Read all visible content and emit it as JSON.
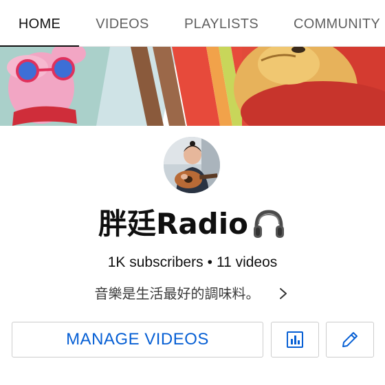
{
  "tabs": [
    {
      "label": "HOME",
      "active": true
    },
    {
      "label": "VIDEOS",
      "active": false
    },
    {
      "label": "PLAYLISTS",
      "active": false
    },
    {
      "label": "COMMUNITY",
      "active": false
    }
  ],
  "channel": {
    "name": "胖廷Radio",
    "name_emoji_icon": "headphones-icon",
    "subscribers": "1K subscribers",
    "separator": "•",
    "videos": "11 videos",
    "description": "音樂是生活最好的調味料。"
  },
  "actions": {
    "manage_label": "MANAGE VIDEOS",
    "analytics_icon": "bar-chart-icon",
    "edit_icon": "pencil-icon"
  },
  "colors": {
    "accent": "#065fd4",
    "active_tab_underline": "#0f0f0f",
    "inactive_tab": "#606060"
  }
}
